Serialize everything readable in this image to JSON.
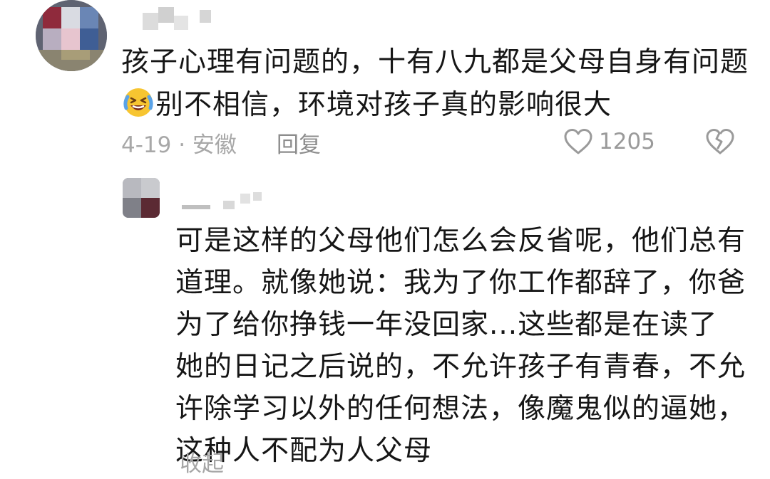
{
  "comment": {
    "text_part1": "孩子心理有问题的，十有八九都是父母自身有问题",
    "emoji": "laughing-crying-face",
    "text_part2": "别不相信，环境对孩子真的影响很大",
    "date_location": "4-19 · 安徽",
    "reply_label": "回复",
    "like_count": "1205",
    "like_icon": "heart-outline-icon",
    "dislike_icon": "broken-heart-icon"
  },
  "reply": {
    "text": "可是这样的父母他们怎么会反省呢，他们总有道理。就像她说：我为了你工作都辞了，你爸为了给你挣钱一年没回家...这些都是在读了她的日记之后说的，不允许孩子有青春，不允许除学习以外的任何想法，像魔鬼似的逼她，这种人不配为人父母",
    "collapse_label": "收起"
  },
  "colors": {
    "text": "#161616",
    "meta": "#a8a8a8",
    "background": "#ffffff"
  }
}
